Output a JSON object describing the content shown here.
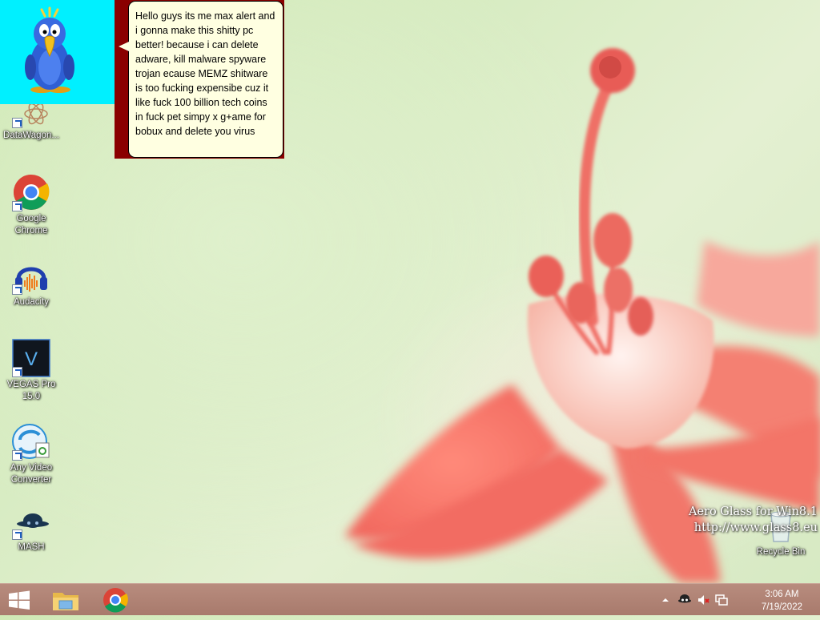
{
  "desktop": {
    "icons": [
      {
        "id": "datawagon",
        "label": "DataWagon..."
      },
      {
        "id": "chrome",
        "label": "Google Chrome"
      },
      {
        "id": "audacity",
        "label": "Audacity"
      },
      {
        "id": "vegas",
        "label": "VEGAS Pro 15.0"
      },
      {
        "id": "avc",
        "label": "Any Video Converter"
      },
      {
        "id": "mash",
        "label": "MASH"
      },
      {
        "id": "recycle",
        "label": "Recycle Bin"
      }
    ]
  },
  "agent": {
    "balloon_text": "Hello guys its me max alert and i gonna make this shitty pc better! because i can delete adware, kill malware spyware trojan ecause MEMZ shitware is too fucking expensibe cuz it like fuck 100 billion tech coins in fuck pet simpy x g+ame for bobux and delete you virus",
    "background_color": "#00f0ff"
  },
  "watermark": {
    "line1": "Aero Glass for Win8.1",
    "line2": "http://www.glass8.eu"
  },
  "taskbar": {
    "pinned": [
      {
        "id": "file-explorer",
        "icon": "folder-icon"
      },
      {
        "id": "chrome",
        "icon": "chrome-icon"
      }
    ],
    "tray": {
      "icons": [
        "show-hidden-icons-chevron",
        "agent-tray-icon",
        "volume-muted-icon",
        "network-icon"
      ],
      "time": "3:06 AM",
      "date": "7/19/2022"
    }
  },
  "colors": {
    "taskbar": "#b08274",
    "balloon": "#ffffe1",
    "balloon_frame": "#8a0000"
  }
}
